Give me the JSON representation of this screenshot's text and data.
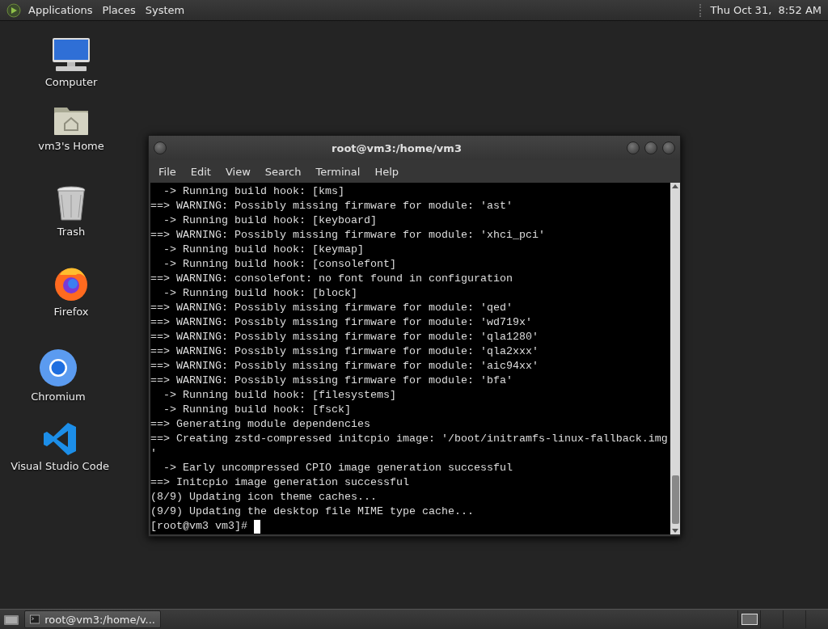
{
  "top_panel": {
    "menus": [
      "Applications",
      "Places",
      "System"
    ],
    "clock": "Thu Oct 31,  8:52 AM"
  },
  "desktop_icons": [
    {
      "label": "Computer",
      "kind": "computer"
    },
    {
      "label": "vm3's Home",
      "kind": "home"
    },
    {
      "label": "Trash",
      "kind": "trash"
    },
    {
      "label": "Firefox",
      "kind": "firefox"
    },
    {
      "label": "Chromium",
      "kind": "chromium"
    },
    {
      "label": "Visual Studio Code",
      "kind": "vscode"
    }
  ],
  "terminal": {
    "title": "root@vm3:/home/vm3",
    "menu": [
      "File",
      "Edit",
      "View",
      "Search",
      "Terminal",
      "Help"
    ],
    "lines": [
      "  -> Running build hook: [kms]",
      "==> WARNING: Possibly missing firmware for module: 'ast'",
      "  -> Running build hook: [keyboard]",
      "==> WARNING: Possibly missing firmware for module: 'xhci_pci'",
      "  -> Running build hook: [keymap]",
      "  -> Running build hook: [consolefont]",
      "==> WARNING: consolefont: no font found in configuration",
      "  -> Running build hook: [block]",
      "==> WARNING: Possibly missing firmware for module: 'qed'",
      "==> WARNING: Possibly missing firmware for module: 'wd719x'",
      "==> WARNING: Possibly missing firmware for module: 'qla1280'",
      "==> WARNING: Possibly missing firmware for module: 'qla2xxx'",
      "==> WARNING: Possibly missing firmware for module: 'aic94xx'",
      "==> WARNING: Possibly missing firmware for module: 'bfa'",
      "  -> Running build hook: [filesystems]",
      "  -> Running build hook: [fsck]",
      "==> Generating module dependencies",
      "==> Creating zstd-compressed initcpio image: '/boot/initramfs-linux-fallback.img",
      "'",
      "  -> Early uncompressed CPIO image generation successful",
      "==> Initcpio image generation successful",
      "(8/9) Updating icon theme caches...",
      "(9/9) Updating the desktop file MIME type cache..."
    ],
    "prompt": "[root@vm3 vm3]#"
  },
  "taskbar": {
    "tasks": [
      {
        "label": "root@vm3:/home/v..."
      }
    ],
    "workspaces": [
      {
        "selected": true
      },
      {
        "selected": false
      },
      {
        "selected": false
      },
      {
        "selected": false
      }
    ]
  }
}
